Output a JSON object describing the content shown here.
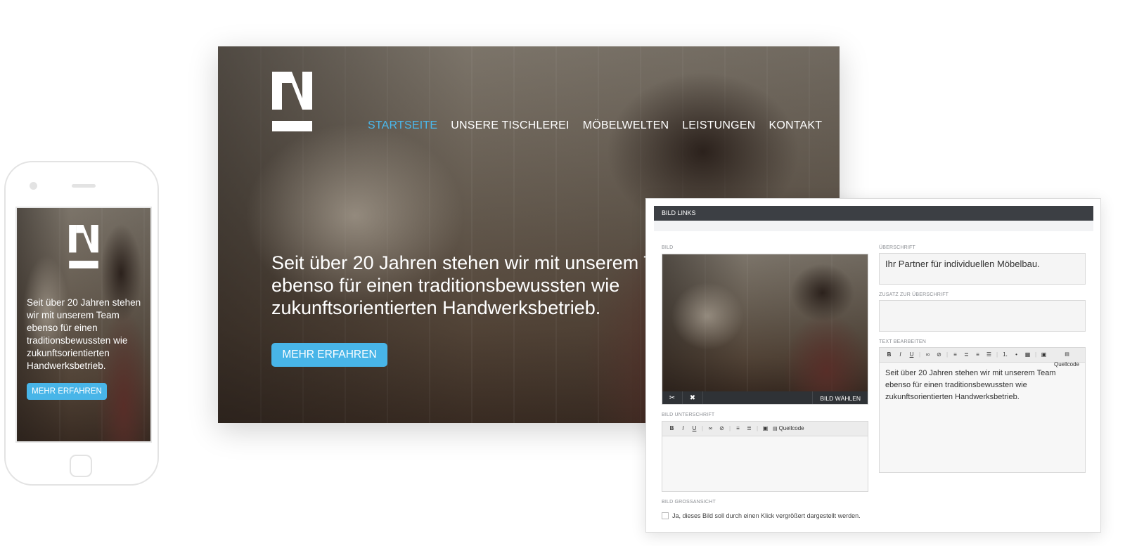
{
  "brand": {
    "accent": "#48b5e8",
    "nav_active": "#4ab8ec",
    "cms_bar": "#3c3f44"
  },
  "phone": {
    "headline": "Seit über 20 Jahren stehen wir mit unserem Team ebenso für einen traditionsbewussten wie zukunftsorientierten Handwerksbetrieb.",
    "cta": "MEHR ERFAHREN"
  },
  "desktop": {
    "nav": [
      {
        "label": "STARTSEITE",
        "active": true
      },
      {
        "label": "UNSERE TISCHLEREI",
        "active": false
      },
      {
        "label": "MÖBELWELTEN",
        "active": false
      },
      {
        "label": "LEISTUNGEN",
        "active": false
      },
      {
        "label": "KONTAKT",
        "active": false
      }
    ],
    "headline": "Seit über 20 Jahren stehen wir mit unserem Team ebenso für einen traditionsbewussten wie zukunftsorientierten Handwerksbetrieb.",
    "cta": "MEHR ERFAHREN"
  },
  "cms": {
    "title": "BILD LINKS",
    "image_label": "BILD",
    "choose_image": "BILD WÄHLEN",
    "caption_label": "BILD UNTERSCHRIFT",
    "zoom_label": "BILD GROSSANSICHT",
    "zoom_checkbox": "Ja, dieses Bild soll durch einen Klick vergrößert dargestellt werden.",
    "heading_label": "ÜBERSCHRIFT",
    "heading_value": "Ihr Partner für individuellen Möbelbau.",
    "subheading_label": "ZUSATZ ZUR ÜBERSCHRIFT",
    "subheading_value": "",
    "text_label": "TEXT BEARBEITEN",
    "text_value": "Seit über 20 Jahren stehen wir mit unserem Team ebenso für einen traditionsbewussten wie zukunftsorientierten Handwerksbetrieb.",
    "source_label": "Quellcode",
    "toolbar_icons": [
      "bold-icon",
      "italic-icon",
      "underline-icon",
      "link-icon",
      "unlink-icon",
      "align-left-icon",
      "align-center-icon",
      "align-right-icon",
      "justify-icon",
      "ordered-list-icon",
      "bullet-list-icon",
      "table-icon",
      "format-icon",
      "source-icon"
    ],
    "image_tools": [
      "crop-icon",
      "remove-icon"
    ]
  }
}
